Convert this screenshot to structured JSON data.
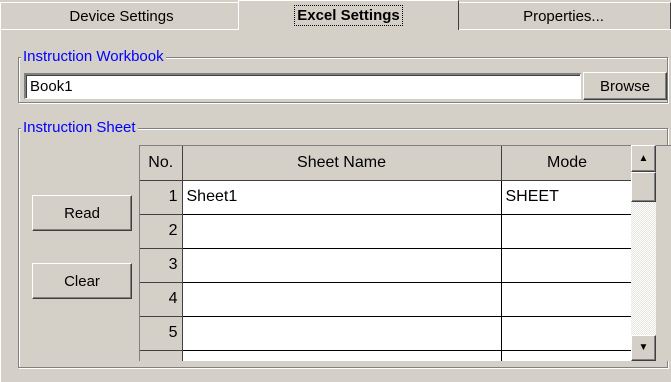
{
  "tabs": [
    {
      "label": "Device Settings",
      "active": false
    },
    {
      "label": "Excel Settings",
      "active": true
    },
    {
      "label": "Properties...",
      "active": false
    }
  ],
  "workbook_group": {
    "legend": "Instruction Workbook",
    "value": "Book1",
    "browse_label": "Browse"
  },
  "sheet_group": {
    "legend": "Instruction Sheet",
    "read_label": "Read",
    "clear_label": "Clear"
  },
  "grid": {
    "headers": {
      "no": "No.",
      "sheet": "Sheet Name",
      "mode": "Mode"
    },
    "rows": [
      {
        "no": "1",
        "sheet": "Sheet1",
        "mode": "SHEET"
      },
      {
        "no": "2",
        "sheet": "",
        "mode": ""
      },
      {
        "no": "3",
        "sheet": "",
        "mode": ""
      },
      {
        "no": "4",
        "sheet": "",
        "mode": ""
      },
      {
        "no": "5",
        "sheet": "",
        "mode": ""
      }
    ]
  },
  "icons": {
    "scroll_up": "arrow-up-icon",
    "scroll_down": "arrow-down-icon"
  },
  "colors": {
    "face": "#d4d0c8",
    "legend_text": "#0000ff",
    "field_bg": "#ffffff"
  }
}
